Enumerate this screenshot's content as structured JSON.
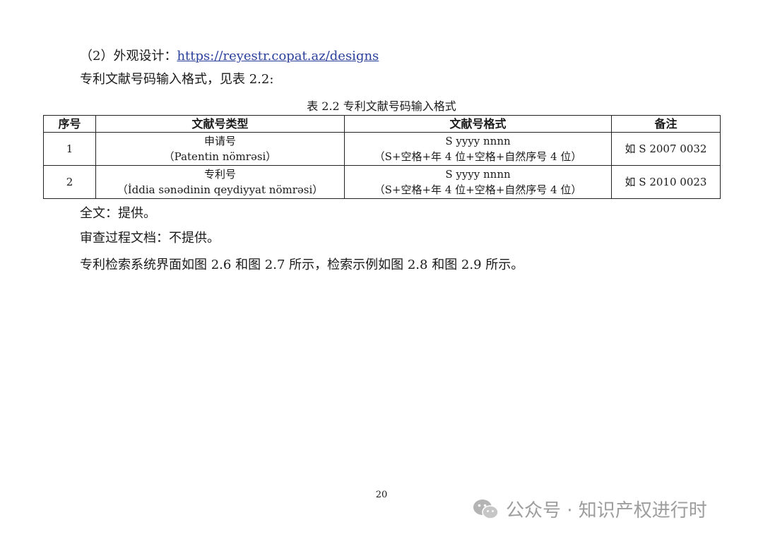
{
  "para_design_prefix": "（2）外观设计：",
  "para_design_link": "https://reyestr.copat.az/designs",
  "para_format": "专利文献号码输入格式，见表 2.2:",
  "table_caption": "表 2.2  专利文献号码输入格式",
  "table": {
    "headers": [
      "序号",
      "文献号类型",
      "文献号格式",
      "备注"
    ],
    "rows": [
      {
        "seq": "1",
        "type_cn": "申请号",
        "type_local": "（Patentin nömrəsi）",
        "format_code": "S yyyy nnnn",
        "format_desc": "（S+空格+年 4 位+空格+自然序号 4 位）",
        "note": "如 S 2007 0032"
      },
      {
        "seq": "2",
        "type_cn": "专利号",
        "type_local": "（İddia sənədinin qeydiyyat nömrəsi）",
        "format_code": "S yyyy nnnn",
        "format_desc": "（S+空格+年 4 位+空格+自然序号 4 位）",
        "note": "如 S 2010 0023"
      }
    ]
  },
  "para_fulltext": "全文：提供。",
  "para_exam": "审查过程文档：不提供。",
  "para_ui": "专利检索系统界面如图 2.6 和图 2.7 所示，检索示例如图 2.8 和图 2.9 所示。",
  "page_number": "20",
  "watermark": {
    "icon": "wechat-icon",
    "text": "公众号 · 知识产权进行时"
  }
}
